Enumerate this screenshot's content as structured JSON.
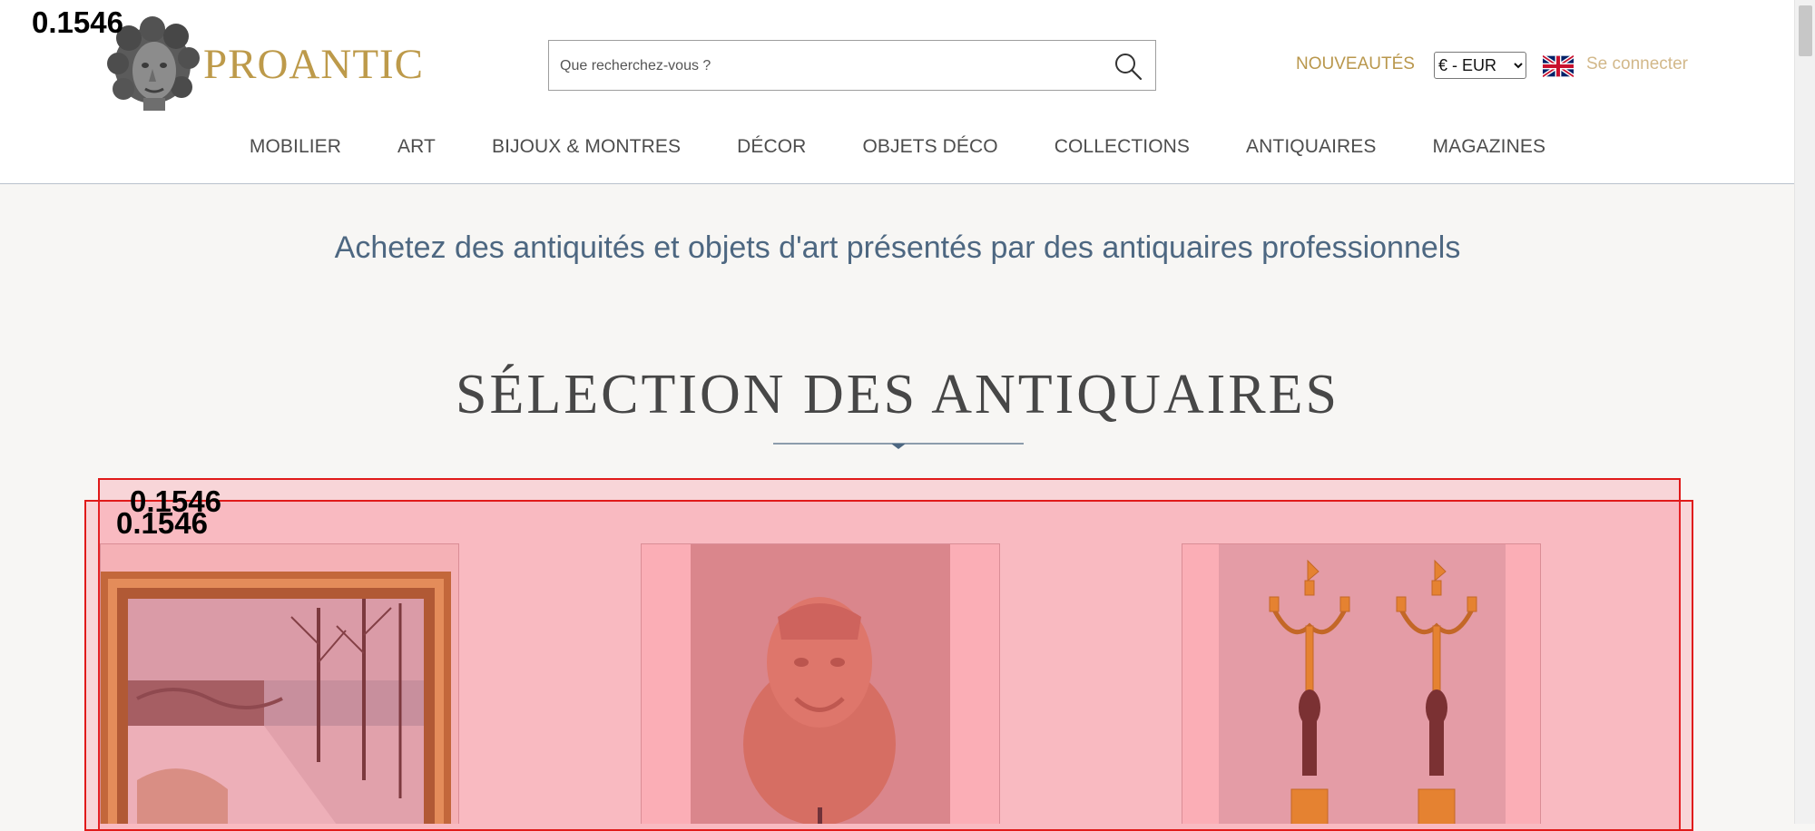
{
  "overlay": {
    "score_top": "0.1546",
    "score_box1": "0.1546",
    "score_box2": "0.1546"
  },
  "header": {
    "brand": "PROANTIC",
    "search_placeholder": "Que recherchez-vous ?",
    "new_label": "NOUVEAUTÉS",
    "currency_options": [
      "€ - EUR"
    ],
    "login_label": "Se connecter",
    "search_icon": "search-icon",
    "flag_icon": "uk-flag-icon"
  },
  "nav": {
    "items": [
      {
        "label": "MOBILIER"
      },
      {
        "label": "ART"
      },
      {
        "label": "BIJOUX & MONTRES"
      },
      {
        "label": "DÉCOR"
      },
      {
        "label": "OBJETS DÉCO"
      },
      {
        "label": "COLLECTIONS"
      },
      {
        "label": "ANTIQUAIRES"
      },
      {
        "label": "MAGAZINES"
      }
    ]
  },
  "main": {
    "tagline": "Achetez des antiquités et objets d'art présentés par des antiquaires professionnels",
    "section_title": "SÉLECTION DES ANTIQUAIRES"
  },
  "products": [
    {
      "image": "winter-painting-image"
    },
    {
      "image": "stone-bust-image"
    },
    {
      "image": "candelabra-pair-image"
    }
  ],
  "colors": {
    "brand": "#bd9a4a",
    "tagline": "#4d6781",
    "highlight": "#e01a1a"
  }
}
